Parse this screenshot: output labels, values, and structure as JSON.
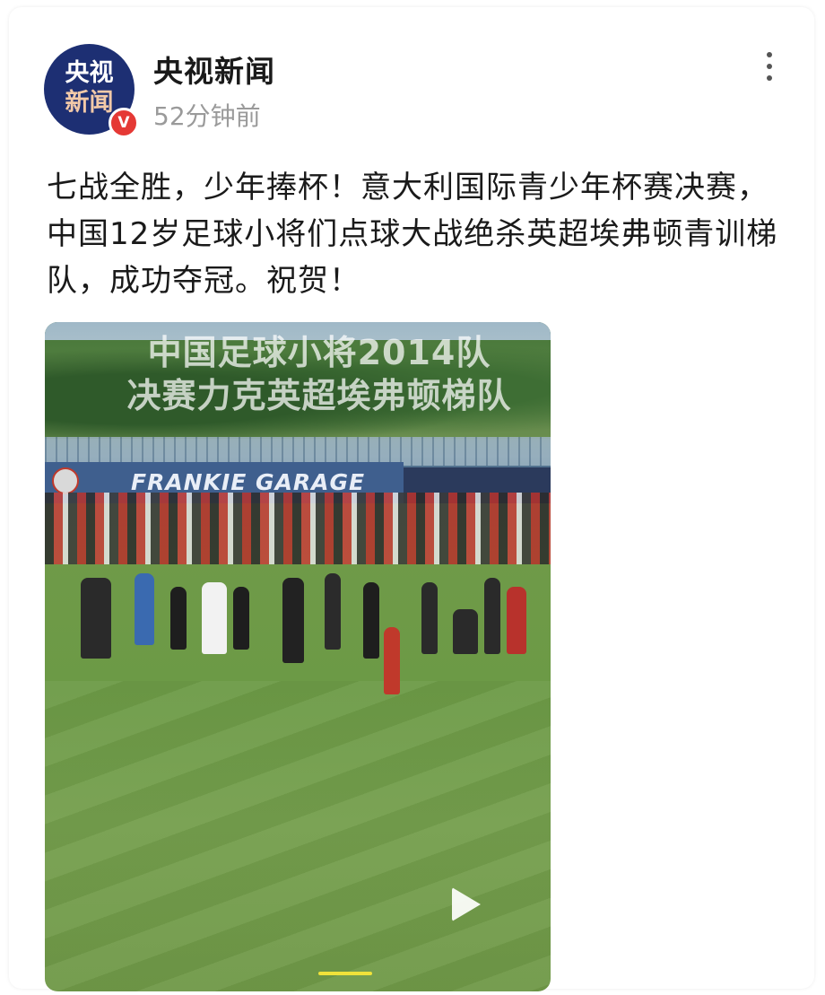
{
  "post": {
    "author": "央视新闻",
    "time": "52分钟前",
    "verified_badge": "V",
    "avatar_text_line1": "央视",
    "avatar_text_line2": "新闻",
    "text": "七战全胜，少年捧杯！意大利国际青少年杯赛决赛，中国12岁足球小将们点球大战绝杀英超埃弗顿青训梯队，成功夺冠。祝贺！"
  },
  "media": {
    "caption_line1": "中国足球小将2014队",
    "caption_line2": "决赛力克英超埃弗顿梯队",
    "banner_text": "FRANKIE GARAGE"
  },
  "icons": {
    "more": "more-vertical-icon",
    "play": "play-icon",
    "verified": "verified-badge-icon"
  },
  "colors": {
    "avatar_bg": "#1d2f73",
    "verified": "#e53935",
    "text": "#1a1a1a",
    "muted": "#9a9a9a"
  }
}
